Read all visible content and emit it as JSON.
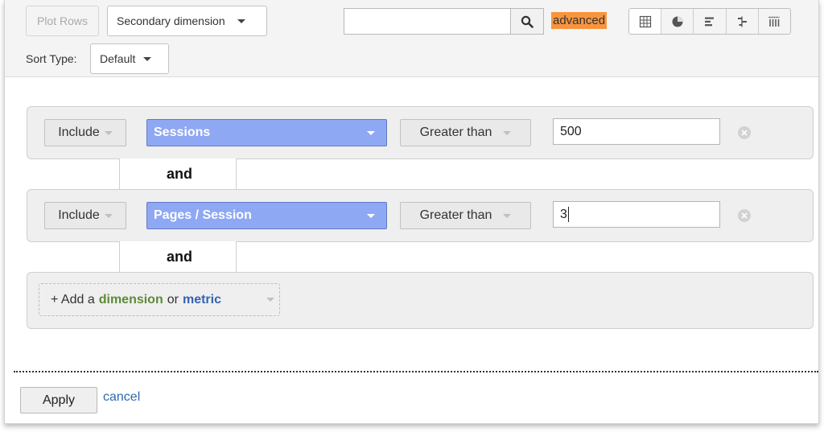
{
  "toolbar": {
    "plot_rows_label": "Plot Rows",
    "secondary_dimension_label": "Secondary dimension",
    "search_value": "",
    "advanced_label": "advanced",
    "sort_type_label": "Sort Type:",
    "sort_type_value": "Default",
    "view_buttons": [
      "table-view",
      "pie-view",
      "performance-view",
      "comparison-view",
      "pivot-view"
    ]
  },
  "filters": [
    {
      "include_label": "Include",
      "metric": "Sessions",
      "condition": "Greater than",
      "value": "500"
    },
    {
      "include_label": "Include",
      "metric": "Pages / Session",
      "condition": "Greater than",
      "value": "3"
    }
  ],
  "connector_label": "and",
  "add_condition": {
    "prefix": "+ Add a",
    "dimension": "dimension",
    "or": "or",
    "metric": "metric"
  },
  "footer": {
    "apply_label": "Apply",
    "cancel_label": "cancel"
  },
  "colors": {
    "metric_select_bg": "#8fa8f3",
    "advanced_highlight": "#f8943e",
    "link": "#2e6ab1",
    "dimension_text": "#5d8a3a"
  }
}
